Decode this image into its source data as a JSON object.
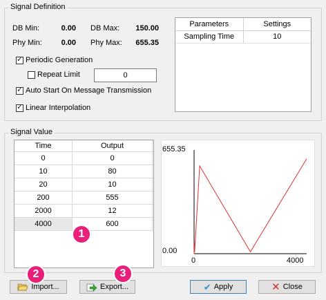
{
  "signal_definition": {
    "title": "Signal Definition",
    "db_min_label": "DB Min:",
    "db_min_value": "0.00",
    "db_max_label": "DB Max:",
    "db_max_value": "150.00",
    "phy_min_label": "Phy Min:",
    "phy_min_value": "0.00",
    "phy_max_label": "Phy Max:",
    "phy_max_value": "655.35",
    "periodic_generation": {
      "label": "Periodic Generation",
      "checked": true
    },
    "repeat_limit": {
      "label": "Repeat Limit",
      "checked": false,
      "value": "0"
    },
    "auto_start": {
      "label": "Auto Start On Message Transmission",
      "checked": true
    },
    "linear_interpolation": {
      "label": "Linear Interpolation",
      "checked": true
    },
    "parameters_table": {
      "headers": [
        "Parameters",
        "Settings"
      ],
      "rows": [
        [
          "Sampling Time",
          "10"
        ]
      ]
    }
  },
  "signal_value": {
    "title": "Signal Value",
    "table": {
      "headers": [
        "Time",
        "Output"
      ],
      "rows": [
        [
          "0",
          "0"
        ],
        [
          "10",
          "80"
        ],
        [
          "20",
          "10"
        ],
        [
          "200",
          "555"
        ],
        [
          "2000",
          "12"
        ],
        [
          "4000",
          "600"
        ]
      ]
    }
  },
  "chart_data": {
    "type": "line",
    "x": [
      0,
      10,
      20,
      200,
      2000,
      4000
    ],
    "y": [
      0,
      80,
      10,
      555,
      12,
      600
    ],
    "y_min_label": "0.00",
    "y_max_label": "655.35",
    "x_min_label": "0",
    "x_max_label": "4000",
    "xlim": [
      0,
      4000
    ],
    "ylim": [
      0,
      655.35
    ],
    "line_color": "#e03030"
  },
  "buttons": {
    "import": "Import...",
    "export": "Export...",
    "apply": "Apply",
    "close": "Close"
  },
  "badges": [
    "1",
    "2",
    "3"
  ],
  "colors": {
    "badge": "#e8207a",
    "apply_border": "#3c7fb1"
  }
}
